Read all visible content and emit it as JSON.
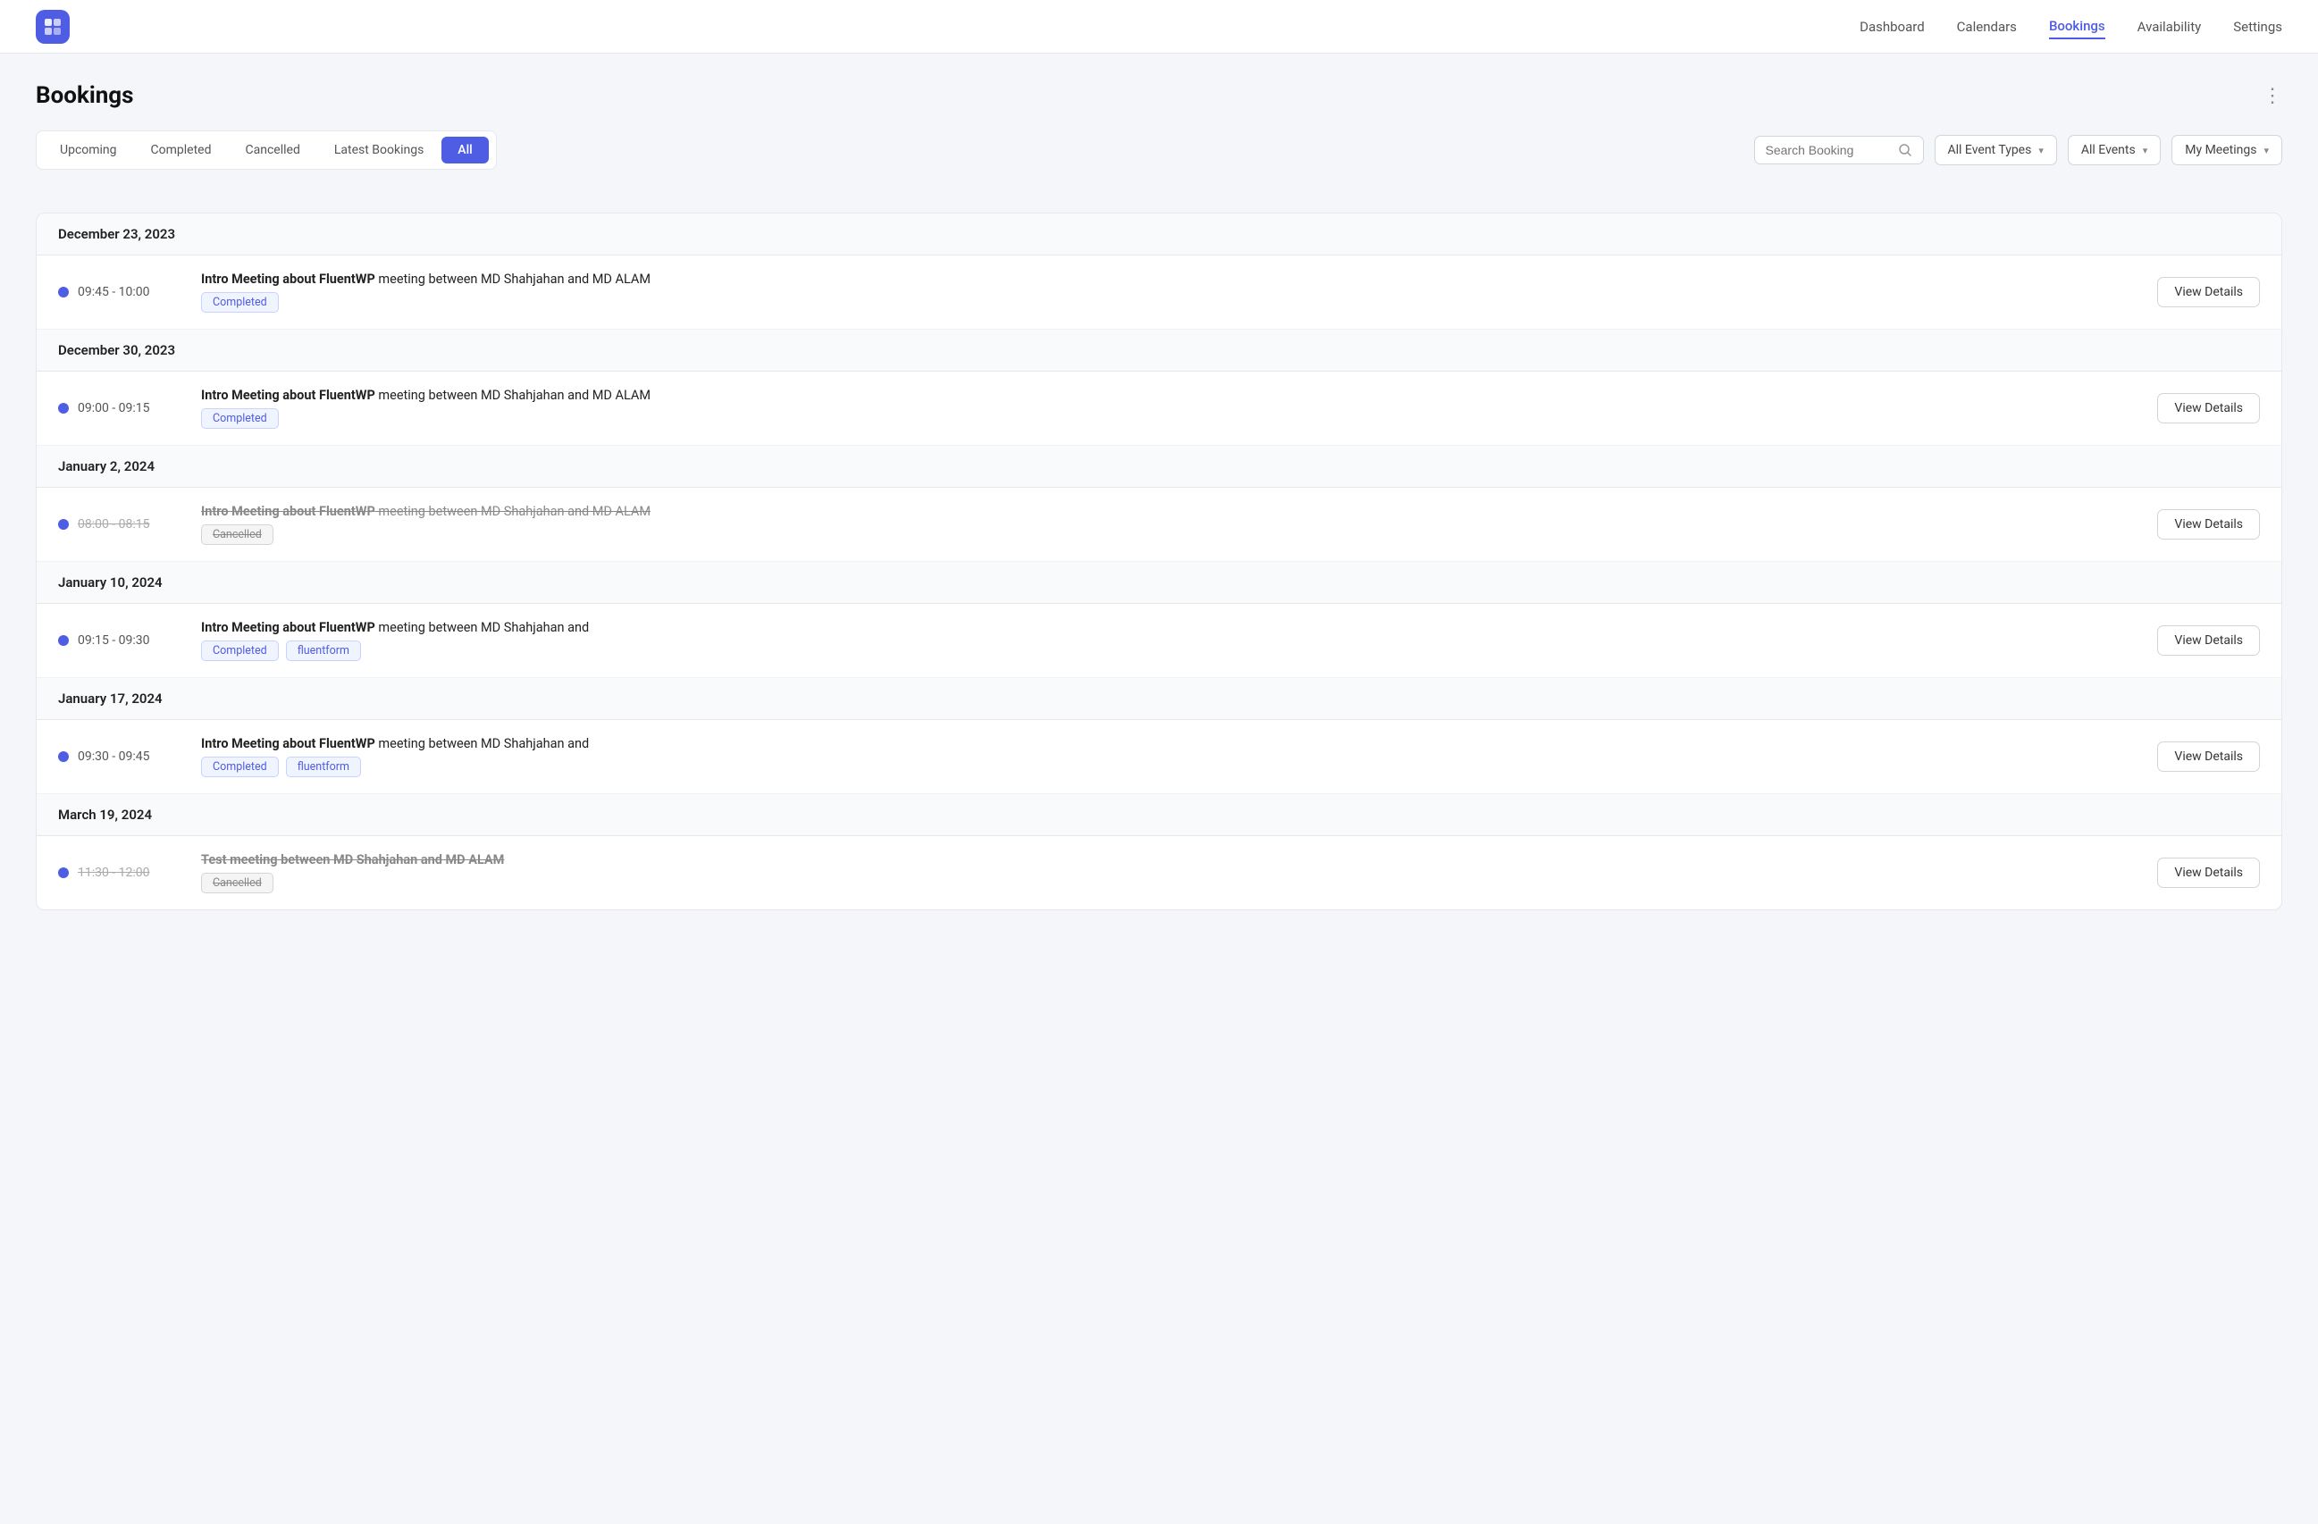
{
  "nav": {
    "links": [
      {
        "id": "dashboard",
        "label": "Dashboard",
        "active": false
      },
      {
        "id": "calendars",
        "label": "Calendars",
        "active": false
      },
      {
        "id": "bookings",
        "label": "Bookings",
        "active": true
      },
      {
        "id": "availability",
        "label": "Availability",
        "active": false
      },
      {
        "id": "settings",
        "label": "Settings",
        "active": false
      }
    ]
  },
  "page": {
    "title": "Bookings",
    "more_icon": "⋮"
  },
  "filters": {
    "tabs": [
      {
        "id": "upcoming",
        "label": "Upcoming",
        "active": false
      },
      {
        "id": "completed",
        "label": "Completed",
        "active": false
      },
      {
        "id": "cancelled",
        "label": "Cancelled",
        "active": false
      },
      {
        "id": "latest",
        "label": "Latest Bookings",
        "active": false
      },
      {
        "id": "all",
        "label": "All",
        "active": true
      }
    ]
  },
  "controls": {
    "search_placeholder": "Search Booking",
    "dropdowns": [
      {
        "id": "event-types",
        "label": "All Event Types"
      },
      {
        "id": "events",
        "label": "All Events"
      },
      {
        "id": "meetings",
        "label": "My Meetings"
      }
    ]
  },
  "booking_groups": [
    {
      "date": "December 23, 2023",
      "bookings": [
        {
          "time": "09:45 - 10:00",
          "strikethrough": false,
          "title_bold": "Intro Meeting about FluentWP",
          "title_rest": " meeting between MD Shahjahan and MD ALAM",
          "title_strikethrough": false,
          "badges": [
            {
              "type": "completed",
              "label": "Completed"
            }
          ],
          "btn_label": "View Details"
        }
      ]
    },
    {
      "date": "December 30, 2023",
      "bookings": [
        {
          "time": "09:00 - 09:15",
          "strikethrough": false,
          "title_bold": "Intro Meeting about FluentWP",
          "title_rest": " meeting between MD Shahjahan and MD ALAM",
          "title_strikethrough": false,
          "badges": [
            {
              "type": "completed",
              "label": "Completed"
            }
          ],
          "btn_label": "View Details"
        }
      ]
    },
    {
      "date": "January 2, 2024",
      "bookings": [
        {
          "time": "08:00 - 08:15",
          "strikethrough": true,
          "title_bold": "Intro Meeting about FluentWP",
          "title_rest": " meeting between MD Shahjahan and MD ALAM",
          "title_strikethrough": true,
          "badges": [
            {
              "type": "cancelled",
              "label": "Cancelled"
            }
          ],
          "btn_label": "View Details"
        }
      ]
    },
    {
      "date": "January 10, 2024",
      "bookings": [
        {
          "time": "09:15 - 09:30",
          "strikethrough": false,
          "title_bold": "Intro Meeting about FluentWP",
          "title_rest": " meeting between MD Shahjahan and",
          "title_strikethrough": false,
          "badges": [
            {
              "type": "completed",
              "label": "Completed"
            },
            {
              "type": "fluentform",
              "label": "fluentform"
            }
          ],
          "btn_label": "View Details"
        }
      ]
    },
    {
      "date": "January 17, 2024",
      "bookings": [
        {
          "time": "09:30 - 09:45",
          "strikethrough": false,
          "title_bold": "Intro Meeting about FluentWP",
          "title_rest": " meeting between MD Shahjahan and",
          "title_strikethrough": false,
          "badges": [
            {
              "type": "completed",
              "label": "Completed"
            },
            {
              "type": "fluentform",
              "label": "fluentform"
            }
          ],
          "btn_label": "View Details"
        }
      ]
    },
    {
      "date": "March 19, 2024",
      "bookings": [
        {
          "time": "11:30 - 12:00",
          "strikethrough": true,
          "title_bold": "Test meeting between MD Shahjahan and MD ALAM",
          "title_rest": "",
          "title_strikethrough": true,
          "badges": [
            {
              "type": "cancelled",
              "label": "Cancelled"
            }
          ],
          "btn_label": "View Details"
        }
      ]
    }
  ]
}
